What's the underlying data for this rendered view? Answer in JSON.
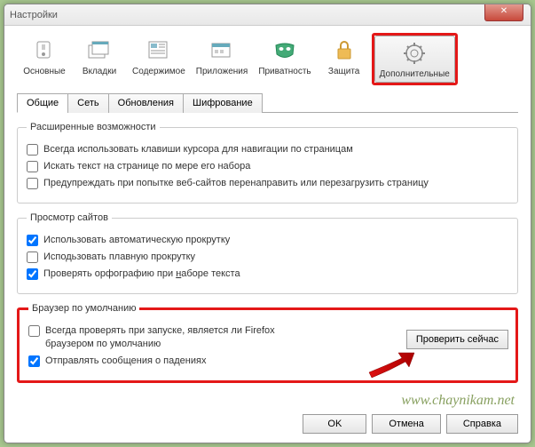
{
  "window": {
    "title": "Настройки",
    "close": "✕"
  },
  "toolbar": {
    "items": [
      {
        "label": "Основные"
      },
      {
        "label": "Вкладки"
      },
      {
        "label": "Содержимое"
      },
      {
        "label": "Приложения"
      },
      {
        "label": "Приватность"
      },
      {
        "label": "Защита"
      },
      {
        "label": "Дополнительные"
      }
    ]
  },
  "subtabs": {
    "items": [
      {
        "label": "Общие"
      },
      {
        "label": "Сеть"
      },
      {
        "label": "Обновления"
      },
      {
        "label": "Шифрование"
      }
    ]
  },
  "groups": {
    "advanced": {
      "legend": "Расширенные возможности",
      "opt1": "Всегда использовать клавиши курсора для навигации по страницам",
      "opt2": "Искать текст на странице по мере его набора",
      "opt3": "Предупреждать при попытке веб-сайтов перенаправить или перезагрузить страницу"
    },
    "browsing": {
      "legend": "Просмотр сайтов",
      "opt1": "Использовать автоматическую прокрутку",
      "opt2": "Исподьзовать плавную прокрутку",
      "opt3_pre": "Проверять орфографию при ",
      "opt3_key": "н",
      "opt3_post": "аборе текста"
    },
    "default": {
      "legend": "Браузер по умолчанию",
      "opt1": "Всегда проверять при запуске, является ли Firefox браузером по умолчанию",
      "opt2": "Отправлять сообщения о падениях",
      "check_now": "Проверить сейчас"
    }
  },
  "buttons": {
    "ok": "OK",
    "cancel": "Отмена",
    "help": "Справка"
  },
  "watermark": "www.chaynikam.net"
}
